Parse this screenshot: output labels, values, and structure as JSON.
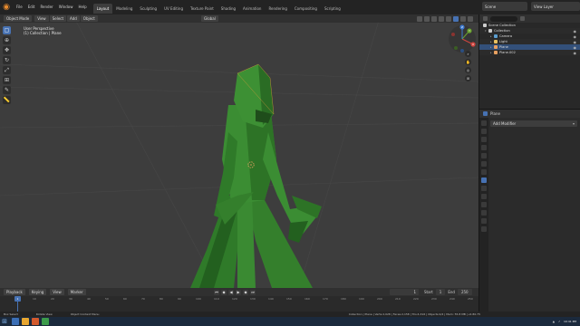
{
  "menu": [
    "File",
    "Edit",
    "Render",
    "Window",
    "Help"
  ],
  "workspaces": [
    "Layout",
    "Modeling",
    "Sculpting",
    "UV Editing",
    "Texture Paint",
    "Shading",
    "Animation",
    "Rendering",
    "Compositing",
    "Scripting"
  ],
  "active_workspace": "Layout",
  "scene_label": "Scene",
  "view_layer_label": "View Layer",
  "viewport": {
    "mode": "Object Mode",
    "view_menus": [
      "View",
      "Select",
      "Add",
      "Object"
    ],
    "orientation": "Global",
    "info_line1": "User Perspective",
    "info_line2": "(1) Collection | Plane"
  },
  "toolbar_icons": [
    "select-box-icon",
    "cursor-icon",
    "move-icon",
    "rotate-icon",
    "scale-icon",
    "transform-icon",
    "annotate-icon",
    "measure-icon"
  ],
  "gizmo": {
    "x": "X",
    "y": "Y",
    "z": "Z"
  },
  "outliner": {
    "root": "Scene Collection",
    "items": [
      {
        "label": "Collection",
        "color": "#cccccc"
      },
      {
        "label": "Camera",
        "color": "#5c9ecf"
      },
      {
        "label": "Light",
        "color": "#e8c060"
      },
      {
        "label": "Plane",
        "color": "#e8a060"
      },
      {
        "label": "Plane.002",
        "color": "#e8a060"
      }
    ]
  },
  "properties": {
    "object_name": "Plane",
    "add_modifier": "Add Modifier"
  },
  "timeline": {
    "playback": "Playback",
    "keying": "Keying",
    "view": "View",
    "marker": "Marker",
    "current_frame": "1",
    "start_label": "Start",
    "start": "1",
    "end_label": "End",
    "end": "250",
    "ruler": [
      "0",
      "10",
      "20",
      "30",
      "40",
      "50",
      "60",
      "70",
      "80",
      "90",
      "100",
      "110",
      "120",
      "130",
      "140",
      "150",
      "160",
      "170",
      "180",
      "190",
      "200",
      "210",
      "220",
      "230",
      "240",
      "250"
    ],
    "playhead": "1"
  },
  "statusbar": {
    "select": "Box Select",
    "rotate": "Rotate View",
    "menu": "Object Context Menu",
    "stats": "Collection | Plane | Verts:2,028 | Faces:2,158 | Tris:4,316 | Objects:0/4 | Mem: 55.8 MB | v2.80.75"
  },
  "taskbar": {
    "time": "10:41 PM",
    "date": "11/28/2019"
  },
  "colors": {
    "accent": "#4772b3",
    "figure": "#3d8a35",
    "figure_dark": "#1f4d1b",
    "background": "#3d3d3d"
  }
}
